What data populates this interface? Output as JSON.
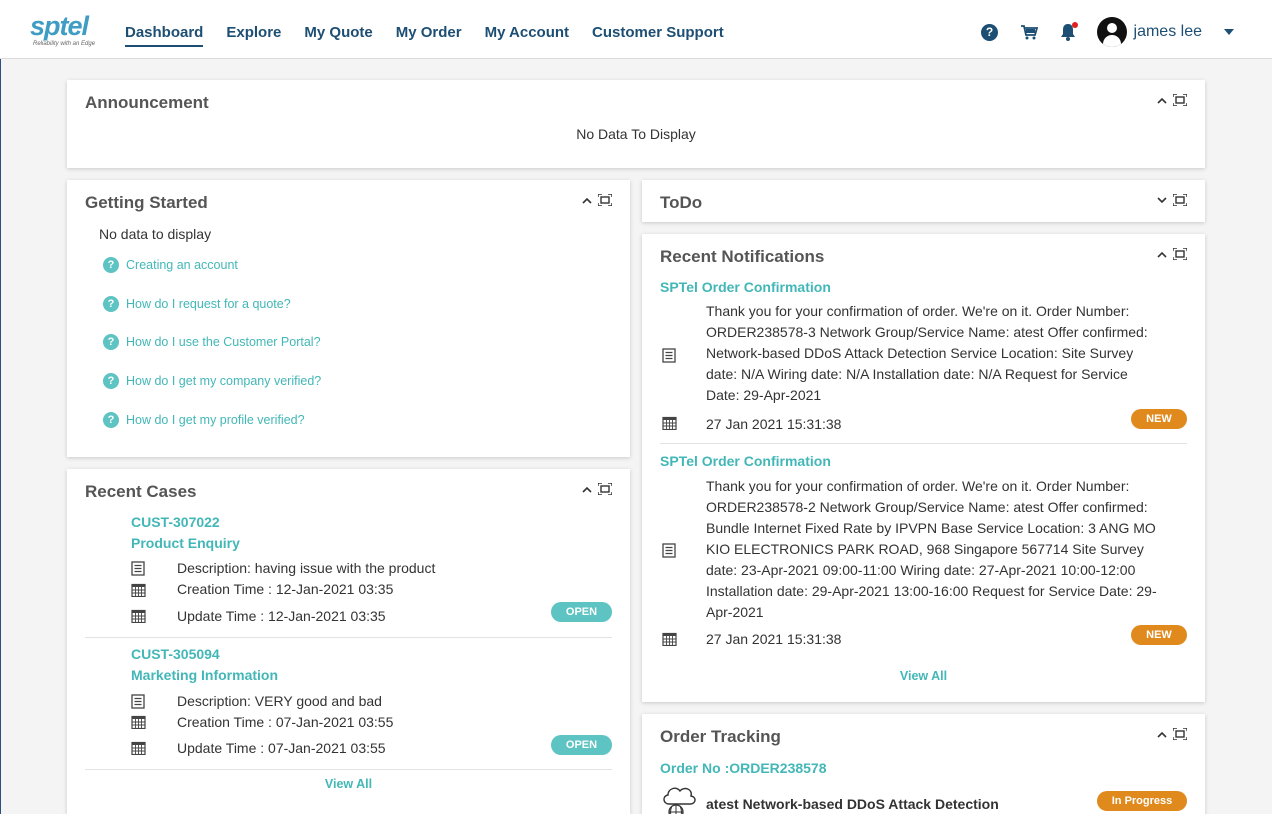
{
  "brand": {
    "name": "sptel",
    "tagline": "Reliability with an Edge",
    "color": "#3f9dc4"
  },
  "nav": {
    "items": [
      {
        "label": "Dashboard",
        "active": true
      },
      {
        "label": "Explore"
      },
      {
        "label": "My Quote"
      },
      {
        "label": "My Order"
      },
      {
        "label": "My Account"
      },
      {
        "label": "Customer Support"
      }
    ],
    "icons": [
      "help-icon",
      "cart-icon",
      "bell-icon"
    ],
    "user": {
      "name": "james lee"
    }
  },
  "colors": {
    "primary": "#1d4e73",
    "teal": "#43b7b7",
    "badge_new": "#e08a1e",
    "badge_open": "#5dc3c3"
  },
  "announcement": {
    "title": "Announcement",
    "empty": "No Data To Display"
  },
  "getting_started": {
    "title": "Getting Started",
    "empty": "No data to display",
    "faqs": [
      "Creating an account",
      "How do I request for a quote?",
      "How do I use the Customer Portal?",
      "How do I get my company verified?",
      "How do I get my profile verified?"
    ]
  },
  "todo": {
    "title": "ToDo"
  },
  "notifications": {
    "title": "Recent Notifications",
    "items": [
      {
        "heading": "SPTel Order Confirmation",
        "lines": [
          "Thank you for your confirmation of order. We're on it. Order Number:",
          "ORDER238578-3 Network Group/Service Name: atest Offer confirmed:",
          "Network-based DDoS Attack Detection Service Location: Site Survey",
          "date: N/A Wiring date: N/A Installation date: N/A Request for Service",
          "Date: 29-Apr-2021"
        ],
        "time": "27 Jan 2021 15:31:38",
        "badge": "NEW"
      },
      {
        "heading": "SPTel Order Confirmation",
        "lines": [
          "Thank you for your confirmation of order. We're on it. Order Number:",
          "ORDER238578-2 Network Group/Service Name: atest Offer confirmed:",
          "Bundle Internet Fixed Rate by IPVPN Base Service Location: 3 ANG MO",
          "KIO ELECTRONICS PARK ROAD, 968 Singapore 567714 Site Survey",
          "date: 23-Apr-2021 09:00-11:00 Wiring date: 27-Apr-2021 10:00-12:00",
          "Installation date: 29-Apr-2021 13:00-16:00 Request for Service Date: 29-",
          "Apr-2021"
        ],
        "time": "27 Jan 2021 15:31:38",
        "badge": "NEW"
      }
    ],
    "view_all": "View All"
  },
  "cases": {
    "title": "Recent Cases",
    "items": [
      {
        "id": "CUST-307022",
        "type": "Product Enquiry",
        "description": "Description: having issue with the product",
        "created": "Creation Time : 12-Jan-2021 03:35",
        "updated": "Update Time : 12-Jan-2021 03:35",
        "status": "OPEN"
      },
      {
        "id": "CUST-305094",
        "type": "Marketing Information",
        "description": "Description: VERY good and bad",
        "created": "Creation Time : 07-Jan-2021 03:55",
        "updated": "Update Time : 07-Jan-2021 03:55",
        "status": "OPEN"
      }
    ],
    "view_all": "View All"
  },
  "order_tracking": {
    "title": "Order Tracking",
    "order_no": "Order No :ORDER238578",
    "item_name": "atest Network-based DDoS Attack Detection",
    "status": "In Progress"
  }
}
